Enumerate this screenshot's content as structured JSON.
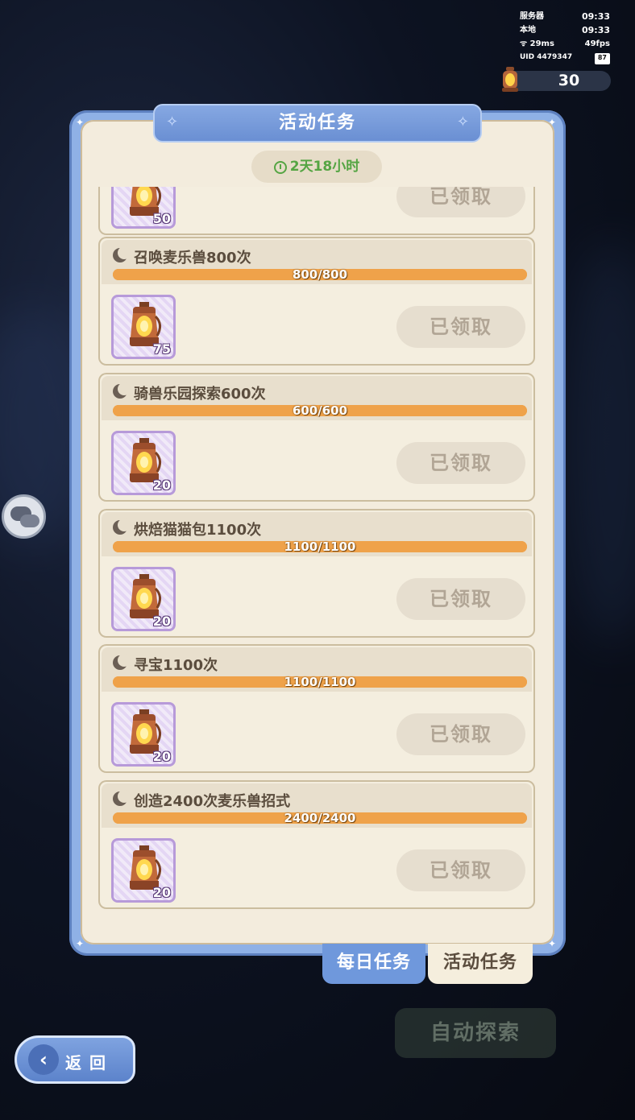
{
  "hud": {
    "server_label": "服务器",
    "server_time": "09:33",
    "local_label": "本地",
    "local_time": "09:33",
    "ping": "29ms",
    "fps": "49fps",
    "uid": "UID 4479347",
    "battery": "87"
  },
  "currency": {
    "amount": "30",
    "icon": "lantern-icon"
  },
  "panel": {
    "title": "活动任务",
    "timer": "2天18小时"
  },
  "tasks": [
    {
      "title": "",
      "progress": "",
      "reward_qty": "50",
      "claim_label": "已领取",
      "progress_fraction": 1
    },
    {
      "title": "召唤麦乐兽800次",
      "progress": "800/800",
      "reward_qty": "75",
      "claim_label": "已领取",
      "progress_fraction": 1
    },
    {
      "title": "骑兽乐园探索600次",
      "progress": "600/600",
      "reward_qty": "20",
      "claim_label": "已领取",
      "progress_fraction": 1
    },
    {
      "title": "烘焙猫猫包1100次",
      "progress": "1100/1100",
      "reward_qty": "20",
      "claim_label": "已领取",
      "progress_fraction": 1
    },
    {
      "title": "寻宝1100次",
      "progress": "1100/1100",
      "reward_qty": "20",
      "claim_label": "已领取",
      "progress_fraction": 1
    },
    {
      "title": "创造2400次麦乐兽招式",
      "progress": "2400/2400",
      "reward_qty": "20",
      "claim_label": "已领取",
      "progress_fraction": 1
    }
  ],
  "tabs": {
    "daily": "每日任务",
    "event": "活动任务"
  },
  "buttons": {
    "auto_explore": "自动探索",
    "back": "返回"
  },
  "colors": {
    "panel_blue": "#8fb1e6",
    "progress_orange": "#f0a648",
    "timer_green": "#55a543"
  }
}
